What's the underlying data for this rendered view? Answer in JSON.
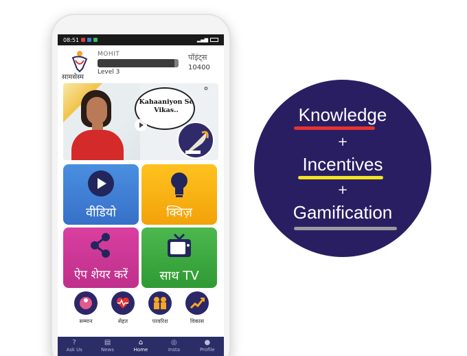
{
  "status_bar": {
    "time": "08:51",
    "right": ""
  },
  "header": {
    "logo_text": "सामसेस्म",
    "username": "MOHIT",
    "level": "Level 3",
    "points_label": "पॉइंट्स",
    "points_value": "10400",
    "progress_fraction": 0.95
  },
  "banner": {
    "bubble_text": "Kahaaniyon Se Vikas.."
  },
  "tiles": {
    "video": "वीडियो",
    "quiz": "क्विज़",
    "share": "ऐप शेयर करें",
    "tv": "साथ TV"
  },
  "categories": [
    {
      "label": "सम्मान"
    },
    {
      "label": "सेहत"
    },
    {
      "label": "परवरिश"
    },
    {
      "label": "विकास"
    }
  ],
  "bottom_nav": [
    {
      "label": "Ask Us",
      "icon": "question-icon"
    },
    {
      "label": "News",
      "icon": "news-icon"
    },
    {
      "label": "Home",
      "icon": "home-icon",
      "active": true
    },
    {
      "label": "Insta",
      "icon": "instagram-icon"
    },
    {
      "label": "Profile",
      "icon": "profile-icon"
    }
  ],
  "badge": {
    "line1": "Knowledge",
    "plus1": "+",
    "line2": "Incentives",
    "plus2": "+",
    "line3": "Gamification",
    "colors": {
      "knowledge": "#e8322f",
      "incentives": "#f3e321",
      "gamification": "#9b9b9b",
      "circle": "#2a1e63"
    }
  }
}
